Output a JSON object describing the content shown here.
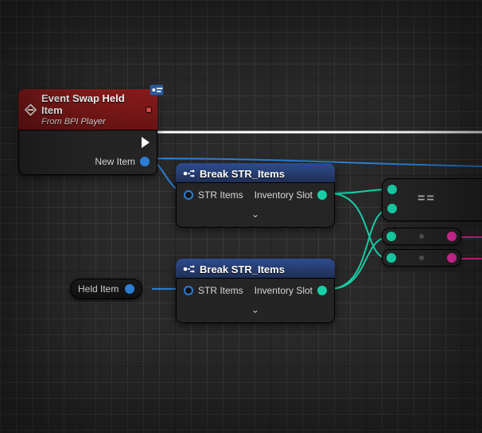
{
  "event": {
    "title": "Event Swap Held Item",
    "subtitle": "From BPI Player",
    "pin_out_label": "",
    "pin_new_item": "New Item"
  },
  "break1": {
    "title": "Break STR_Items",
    "in_label": "STR Items",
    "out_label": "Inventory Slot"
  },
  "break2": {
    "title": "Break STR_Items",
    "in_label": "STR Items",
    "out_label": "Inventory Slot"
  },
  "held_item": {
    "label": "Held Item"
  },
  "equals": {
    "symbol": "=="
  }
}
